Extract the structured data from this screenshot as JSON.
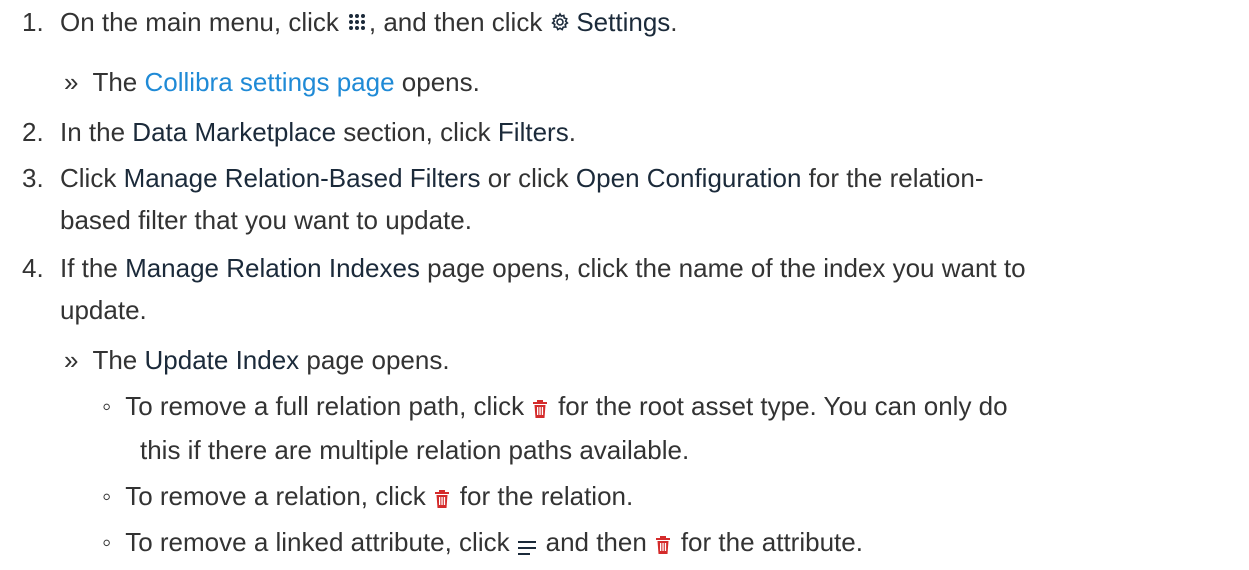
{
  "steps": {
    "s1": {
      "num": "1.",
      "t1": "On the main menu, click",
      "t2": ", and then click",
      "settings": "Settings",
      "t3": ".",
      "icons": [
        "menu-grid-icon",
        "gear-icon"
      ]
    },
    "r1": {
      "bullet": "»",
      "t1": "The",
      "link": "Collibra settings page",
      "t2": "opens."
    },
    "s2": {
      "num": "2.",
      "t1": "In the",
      "dm": "Data Marketplace",
      "t2": "section, click",
      "filters": "Filters",
      "t3": "."
    },
    "s3": {
      "num": "3.",
      "t1": "Click",
      "mrbf": "Manage Relation-Based Filters",
      "t2": "or click",
      "oc": "Open Configuration",
      "t3": "for the relation-",
      "t4": "based filter that you want to update."
    },
    "s4": {
      "num": "4.",
      "t1": "If the",
      "mri": "Manage Relation Indexes",
      "t2": "page opens, click the name of the index you want to",
      "t3": "update."
    },
    "r4": {
      "bullet": "»",
      "t1": "The",
      "ui": "Update Index",
      "t2": "page opens."
    },
    "sub1": {
      "bullet": "◦",
      "t1": "To remove a full relation path, click",
      "t2": "for the root asset type. You can only do",
      "t3": "this if there are multiple relation paths available."
    },
    "sub2": {
      "bullet": "◦",
      "t1": "To remove a relation, click",
      "t2": "for the relation."
    },
    "sub3": {
      "bullet": "◦",
      "t1": "To remove a linked attribute, click",
      "t2": "and then",
      "t3": "for the attribute."
    }
  },
  "colors": {
    "text": "#333333",
    "bold_text": "#1b2a3a",
    "link": "#1f8ad6",
    "trash_icon": "#d42b2b"
  },
  "icon_names": [
    "menu-grid-icon",
    "gear-icon",
    "trash-icon",
    "list-lines-icon"
  ]
}
